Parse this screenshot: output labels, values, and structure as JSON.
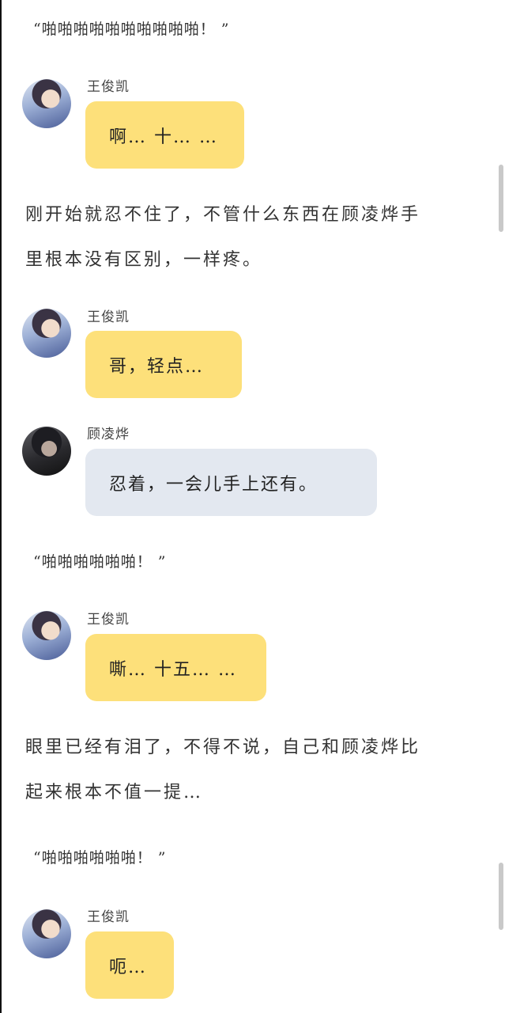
{
  "colors": {
    "wang_bubble": "#fde07a",
    "gu_bubble": "#e3e8f0",
    "background": "#ffffff"
  },
  "blocks": [
    {
      "type": "quote",
      "text": "“啪啪啪啪啪啪啪啪啪啪！ ”"
    },
    {
      "type": "message",
      "speaker": "王俊凯",
      "avatar": "wang-avatar",
      "text": "啊…  十…  …"
    },
    {
      "type": "narration",
      "lines": [
        "刚开始就忍不住了，不管什么东西在顾凌烨手",
        "里根本没有区别，一样疼。"
      ]
    },
    {
      "type": "message",
      "speaker": "王俊凯",
      "avatar": "wang-avatar",
      "text": "哥，轻点…"
    },
    {
      "type": "message",
      "speaker": "顾凌烨",
      "avatar": "gu-avatar",
      "text": "忍着，一会儿手上还有。"
    },
    {
      "type": "quote",
      "text": "“啪啪啪啪啪啪！ ”"
    },
    {
      "type": "message",
      "speaker": "王俊凯",
      "avatar": "wang-avatar",
      "text": "嘶…  十五…  …"
    },
    {
      "type": "narration",
      "lines": [
        "眼里已经有泪了，不得不说，自己和顾凌烨比",
        "起来根本不值一提…"
      ]
    },
    {
      "type": "quote",
      "text": "“啪啪啪啪啪啪！ ”"
    },
    {
      "type": "message",
      "speaker": "王俊凯",
      "avatar": "wang-avatar",
      "text": "呃…"
    }
  ]
}
